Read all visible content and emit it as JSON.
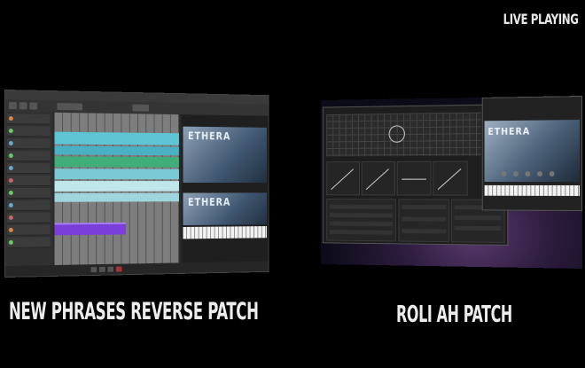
{
  "badge": "LIVE PLAYING",
  "captions": {
    "left": "NEW PHRASES REVERSE PATCH",
    "right": "ROLI AH PATCH"
  },
  "left_screen": {
    "plugin_title_top": "ETHERA",
    "plugin_title_bottom": "ETHERA",
    "clip_colors": [
      "#5fc4d4",
      "#42b86b",
      "#7a3fd9",
      "#d7d7d7"
    ]
  },
  "right_screen": {
    "plugin_title": "ETHERA"
  }
}
